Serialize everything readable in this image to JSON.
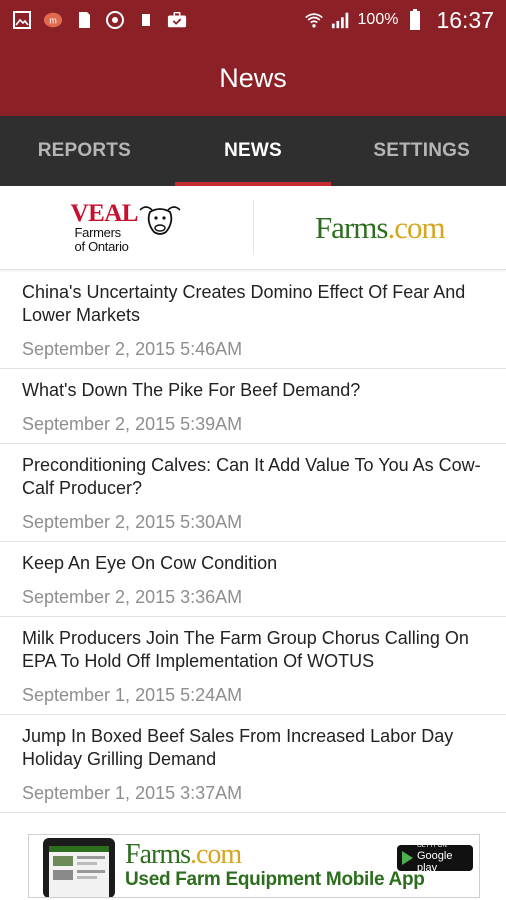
{
  "status_bar": {
    "battery_text": "100%",
    "time": "16:37",
    "left_icons": [
      "image-icon",
      "messenger-icon",
      "sim-icon",
      "sync-icon",
      "notification-icon",
      "briefcase-check-icon"
    ],
    "right_icons": [
      "wifi-icon",
      "signal-icon",
      "battery-icon"
    ]
  },
  "app_bar": {
    "title": "News"
  },
  "tabs": [
    {
      "label": "REPORTS",
      "active": false
    },
    {
      "label": "NEWS",
      "active": true
    },
    {
      "label": "SETTINGS",
      "active": false
    }
  ],
  "sponsors": {
    "veal": {
      "word": "VEAL",
      "line1": "Farmers",
      "line2": "of Ontario"
    },
    "farms": {
      "name": "Farms",
      "suffix": ".com"
    }
  },
  "news": [
    {
      "title": "China's Uncertainty Creates Domino Effect Of Fear And Lower Markets",
      "date": "September 2, 2015 5:46AM"
    },
    {
      "title": "What's Down The Pike For Beef Demand?",
      "date": "September 2, 2015 5:39AM"
    },
    {
      "title": "Preconditioning Calves: Can It Add Value To You As Cow-Calf Producer?",
      "date": "September 2, 2015 5:30AM"
    },
    {
      "title": "Keep An Eye On Cow Condition",
      "date": "September 2, 2015 3:36AM"
    },
    {
      "title": "Milk Producers Join The Farm Group Chorus Calling On EPA To Hold Off Implementation Of WOTUS",
      "date": "September 1, 2015 5:24AM"
    },
    {
      "title": "Jump In Boxed Beef Sales From Increased Labor Day Holiday Grilling Demand",
      "date": "September 1, 2015 3:37AM"
    }
  ],
  "ad": {
    "brand": "Farms",
    "brand_suffix": ".com",
    "tagline": "Used Farm Equipment Mobile App",
    "badge_small": "GET IT ON",
    "badge_big": "Google play"
  },
  "colors": {
    "app_bar": "#8b2027",
    "tab_bar": "#2f2f2f",
    "tab_indicator": "#c72b32",
    "veal_red": "#c8102e",
    "farms_green": "#2c6e1e",
    "farms_gold": "#d7a61e"
  }
}
